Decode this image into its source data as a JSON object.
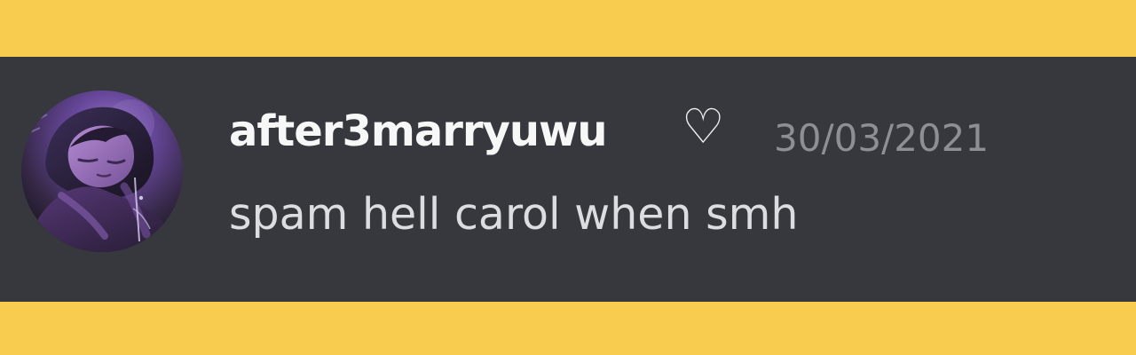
{
  "message": {
    "username": "after3marryuwu",
    "username_badge": "♡",
    "timestamp": "30/03/2021",
    "text": "spam hell carol when smh",
    "avatar_icon": "user-avatar-icon"
  },
  "colors": {
    "background": "#f8cc4f",
    "card": "#36383d",
    "username": "#f7f7f7",
    "timestamp": "#8d8f94",
    "message_text": "#dcdde0"
  }
}
